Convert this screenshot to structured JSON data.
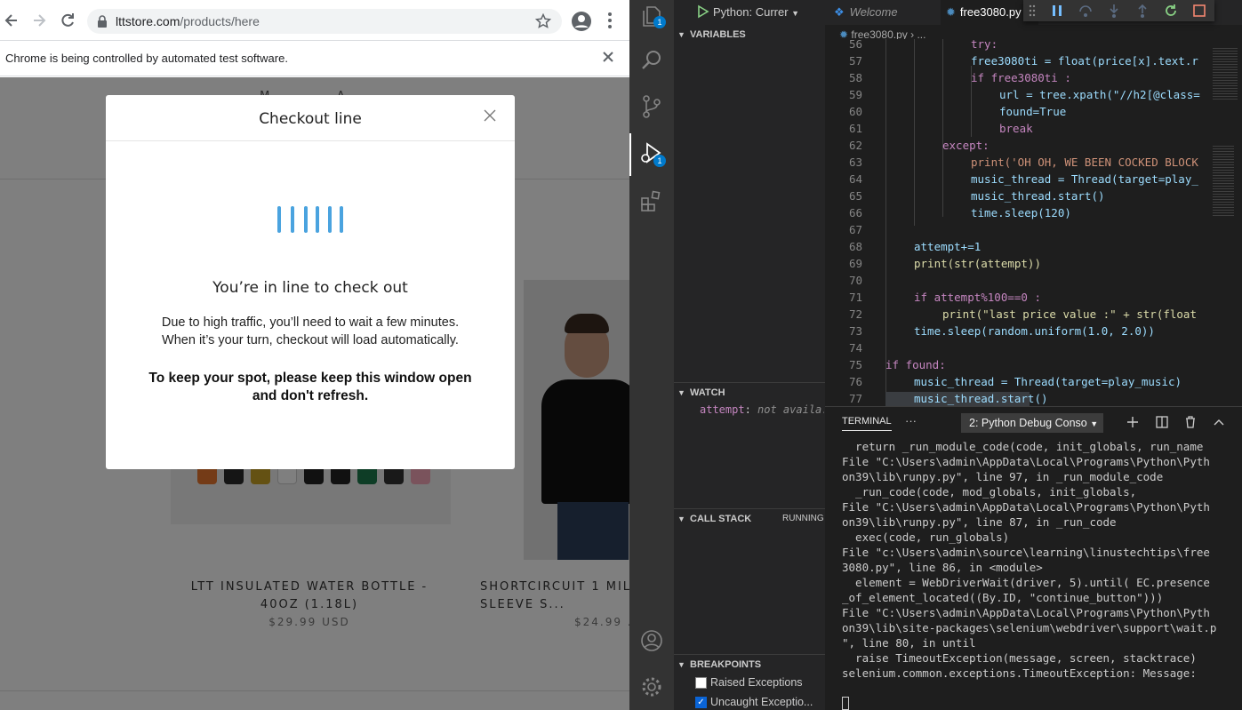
{
  "browser": {
    "url_domain": "lttstore.com",
    "url_path": "/products/here",
    "infobar_text": "Chrome is being controlled by automated test software."
  },
  "page": {
    "header_partial": "M............A...",
    "products": [
      {
        "name": "LTT INSULATED WATER BOTTLE - 40OZ (1.18L)",
        "price": "$29.99 USD"
      },
      {
        "name": "SHORTCIRCUIT 1 MIL... SLEEVE S...",
        "price": "$24.99 ..."
      }
    ]
  },
  "modal": {
    "title": "Checkout line",
    "heading": "You’re in line to check out",
    "para1_line1": "Due to high traffic, you’ll need to wait a few minutes.",
    "para1_line2": "When it’s your turn, checkout will load automatically.",
    "para2_line1": "To keep your spot, please keep this window open",
    "para2_line2": "and don't refresh.",
    "spinner_color": "#4aa3df"
  },
  "vscode": {
    "run_config": "Python: Currer",
    "tabs": [
      "Welcome",
      "free3080.py"
    ],
    "breadcrumb_file": "free3080.py",
    "breadcrumb_sep": "›  ...",
    "badges": {
      "explorer": "1",
      "debug": "1"
    },
    "sections": {
      "variables": "VARIABLES",
      "watch": "WATCH",
      "call_stack": "CALL STACK",
      "call_stack_status": "RUNNING",
      "breakpoints": "BREAKPOINTS"
    },
    "watch_item": {
      "name": "attempt",
      "value": "not availa..."
    },
    "breakpoints": [
      {
        "label": "Raised Exceptions",
        "checked": false
      },
      {
        "label": "Uncaught Exceptio...",
        "checked": true
      }
    ],
    "line_numbers": [
      "56",
      "57",
      "58",
      "59",
      "60",
      "61",
      "62",
      "63",
      "64",
      "65",
      "66",
      "67",
      "68",
      "69",
      "70",
      "71",
      "72",
      "73",
      "74",
      "75",
      "76",
      "77"
    ],
    "code": {
      "l56": "try:",
      "l57": "free3080ti = float(price[x].text.r",
      "l58": "if free3080ti :",
      "l59": "url = tree.xpath(\"//h2[@class=",
      "l60": "found=True",
      "l61": "break",
      "l62": "except:",
      "l63": "print('OH OH, WE BEEN COCKED BLOCK",
      "l64": "music_thread = Thread(target=play_",
      "l65": "music_thread.start()",
      "l66": "time.sleep(120)",
      "l68": "attempt+=1",
      "l69": "print(str(attempt))",
      "l71": "if attempt%100==0 :",
      "l72": "print(\"last price value :\" + str(float",
      "l73": "time.sleep(random.uniform(1.0, 2.0))",
      "l75": "if found:",
      "l76": "music_thread = Thread(target=play_music)",
      "l77": "music_thread.start()"
    },
    "terminal": {
      "tab_label": "TERMINAL",
      "more": "···",
      "dropdown": "2: Python Debug Conso",
      "output": "  return _run_module_code(code, init_globals, run_name\nFile \"C:\\Users\\admin\\AppData\\Local\\Programs\\Python\\Pyth\non39\\lib\\runpy.py\", line 97, in _run_module_code\n  _run_code(code, mod_globals, init_globals,\nFile \"C:\\Users\\admin\\AppData\\Local\\Programs\\Python\\Pyth\non39\\lib\\runpy.py\", line 87, in _run_code\n  exec(code, run_globals)\nFile \"c:\\Users\\admin\\source\\learning\\linustechtips\\free\n3080.py\", line 86, in <module>\n  element = WebDriverWait(driver, 5).until( EC.presence\n_of_element_located((By.ID, \"continue_button\")))\nFile \"C:\\Users\\admin\\AppData\\Local\\Programs\\Python\\Pyth\non39\\lib\\site-packages\\selenium\\webdriver\\support\\wait.p\n\", line 80, in until\n  raise TimeoutException(message, screen, stacktrace)\nselenium.common.exceptions.TimeoutException: Message:"
    }
  }
}
